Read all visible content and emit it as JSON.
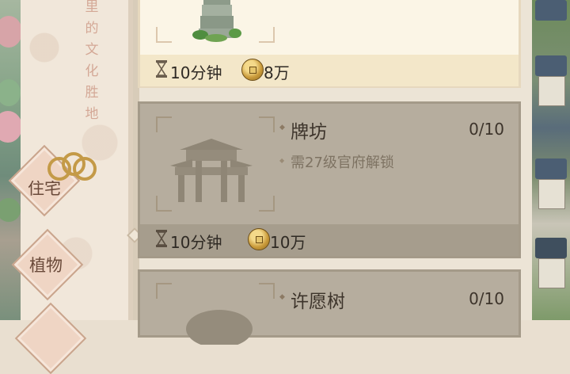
{
  "side_text_chars": [
    "里",
    "的",
    "文",
    "化",
    "胜",
    "地"
  ],
  "categories": [
    {
      "label": "住宅"
    },
    {
      "label": "植物"
    }
  ],
  "buildings": [
    {
      "name": "",
      "count": "",
      "unlock_req": "",
      "time": "10分钟",
      "cost": "8万",
      "state": "unlocked"
    },
    {
      "name": "牌坊",
      "count": "0/10",
      "unlock_req": "需27级官府解锁",
      "time": "10分钟",
      "cost": "10万",
      "state": "locked"
    },
    {
      "name": "许愿树",
      "count": "0/10",
      "unlock_req": "",
      "time": "",
      "cost": "",
      "state": "locked"
    }
  ],
  "colors": {
    "accent_gold": "#c49a47",
    "locked_card": "#b6ad9e",
    "unlocked_card": "#fbf5e6"
  },
  "icons": {
    "timer": "hourglass-icon",
    "currency": "copper-coin-icon"
  }
}
